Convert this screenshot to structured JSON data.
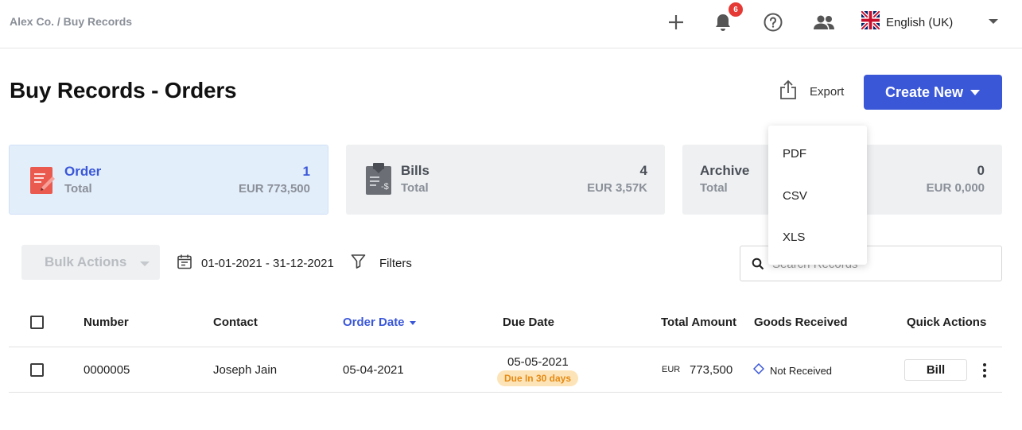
{
  "breadcrumb": "Alex Co. / Buy Records",
  "topbar": {
    "notification_count": "6",
    "language": "English (UK)",
    "icons": [
      "plus-icon",
      "bell-icon",
      "help-icon",
      "users-icon",
      "uk-flag-icon",
      "chevron-down-icon"
    ]
  },
  "page": {
    "title": "Buy Records - Orders",
    "export_label": "Export",
    "create_label": "Create New"
  },
  "export_menu": {
    "items": [
      "PDF",
      "CSV",
      "XLS"
    ]
  },
  "cards": [
    {
      "title": "Order",
      "subtitle": "Total",
      "count": "1",
      "amount": "EUR 773,500",
      "active": true,
      "icon": "order-doc-icon"
    },
    {
      "title": "Bills",
      "subtitle": "Total",
      "count": "4",
      "amount": "EUR 3,57K",
      "active": false,
      "icon": "bill-clipboard-icon"
    },
    {
      "title": "Archive",
      "subtitle": "Total",
      "count": "0",
      "amount": "EUR 0,000",
      "active": false,
      "icon": ""
    }
  ],
  "toolbar": {
    "bulk_actions": "Bulk Actions",
    "date_range": "01-01-2021 - 31-12-2021",
    "filters": "Filters",
    "search_placeholder": "Search Records"
  },
  "table": {
    "headers": {
      "number": "Number",
      "contact": "Contact",
      "order_date": "Order Date",
      "due_date": "Due Date",
      "total_amount": "Total Amount",
      "goods_received": "Goods Received",
      "quick_actions": "Quick Actions"
    },
    "sorted_column": "order_date",
    "rows": [
      {
        "number": "0000005",
        "contact": "Joseph Jain",
        "order_date": "05-04-2021",
        "due_date": "05-05-2021",
        "due_badge": "Due In 30 days",
        "currency": "EUR",
        "amount": "773,500",
        "goods_status": "Not Received",
        "quick_action": "Bill"
      }
    ]
  },
  "colors": {
    "accent": "#3a57d8",
    "badge_red": "#e53935",
    "due_badge_bg": "#fde4b8",
    "due_badge_text": "#e58a12",
    "active_card_bg": "#e3eefb"
  }
}
